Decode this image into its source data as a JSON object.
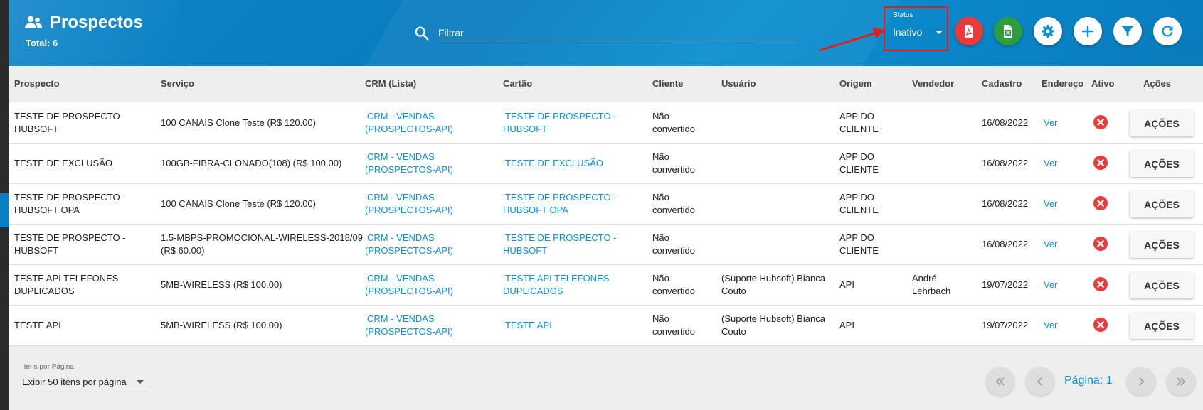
{
  "header": {
    "title": "Prospectos",
    "total": "Total: 6",
    "search_placeholder": "Filtrar",
    "status_label": "Status",
    "status_value": "Inativo"
  },
  "toolbar": {
    "pdf_icon": "pdf-icon",
    "excel_icon": "excel-icon",
    "settings_icon": "gear-icon",
    "add_icon": "plus-icon",
    "filter_icon": "filter-icon",
    "refresh_icon": "refresh-icon"
  },
  "colors": {
    "header": "#0a7fc4",
    "accent_link": "#0a8fd8",
    "danger": "#ea3a3a",
    "excel": "#2e9d3d"
  },
  "columns": [
    "Prospecto",
    "Serviço",
    "CRM (Lista)",
    "Cartão",
    "Cliente",
    "Usuário",
    "Origem",
    "Vendedor",
    "Cadastro",
    "Endereço",
    "Ativo",
    "Ações"
  ],
  "rows": [
    {
      "prospecto": [
        "TESTE DE PROSPECTO -",
        "HUBSOFT"
      ],
      "servico": [
        "100 CANAIS Clone Teste (R$ 120.00)"
      ],
      "crm": [
        "CRM - VENDAS",
        "(PROSPECTOS-API)"
      ],
      "cartao": [
        "TESTE DE PROSPECTO -",
        "HUBSOFT"
      ],
      "cliente": [
        "Não",
        "convertido"
      ],
      "usuario": [],
      "origem": [
        "APP DO",
        "CLIENTE"
      ],
      "vendedor": [],
      "cadastro": "16/08/2022",
      "endereco": "Ver",
      "acoes": "AÇÕES"
    },
    {
      "prospecto": [
        "TESTE DE EXCLUSÃO"
      ],
      "servico": [
        "100GB-FIBRA-CLONADO(108) (R$ 100.00)"
      ],
      "crm": [
        "CRM - VENDAS",
        "(PROSPECTOS-API)"
      ],
      "cartao": [
        "TESTE DE EXCLUSÃO"
      ],
      "cliente": [
        "Não",
        "convertido"
      ],
      "usuario": [],
      "origem": [
        "APP DO",
        "CLIENTE"
      ],
      "vendedor": [],
      "cadastro": "16/08/2022",
      "endereco": "Ver",
      "acoes": "AÇÕES"
    },
    {
      "prospecto": [
        "TESTE DE PROSPECTO -",
        "HUBSOFT OPA"
      ],
      "servico": [
        "100 CANAIS Clone Teste (R$ 120.00)"
      ],
      "crm": [
        "CRM - VENDAS",
        "(PROSPECTOS-API)"
      ],
      "cartao": [
        "TESTE DE PROSPECTO -",
        "HUBSOFT OPA"
      ],
      "cliente": [
        "Não",
        "convertido"
      ],
      "usuario": [],
      "origem": [
        "APP DO",
        "CLIENTE"
      ],
      "vendedor": [],
      "cadastro": "16/08/2022",
      "endereco": "Ver",
      "acoes": "AÇÕES"
    },
    {
      "prospecto": [
        "TESTE DE PROSPECTO -",
        "HUBSOFT"
      ],
      "servico": [
        "1.5-MBPS-PROMOCIONAL-WIRELESS-2018/09",
        "(R$ 60.00)"
      ],
      "crm": [
        "CRM - VENDAS",
        "(PROSPECTOS-API)"
      ],
      "cartao": [
        "TESTE DE PROSPECTO -",
        "HUBSOFT"
      ],
      "cliente": [
        "Não",
        "convertido"
      ],
      "usuario": [],
      "origem": [
        "APP DO",
        "CLIENTE"
      ],
      "vendedor": [],
      "cadastro": "16/08/2022",
      "endereco": "Ver",
      "acoes": "AÇÕES"
    },
    {
      "prospecto": [
        "TESTE API TELEFONES",
        "DUPLICADOS"
      ],
      "servico": [
        "5MB-WIRELESS (R$ 100.00)"
      ],
      "crm": [
        "CRM - VENDAS",
        "(PROSPECTOS-API)"
      ],
      "cartao": [
        "TESTE API TELEFONES",
        "DUPLICADOS"
      ],
      "cliente": [
        "Não",
        "convertido"
      ],
      "usuario": [
        "(Suporte Hubsoft) Bianca",
        "Couto"
      ],
      "origem": [
        "API"
      ],
      "vendedor": [
        "André",
        "Lehrbach"
      ],
      "cadastro": "19/07/2022",
      "endereco": "Ver",
      "acoes": "AÇÕES"
    },
    {
      "prospecto": [
        "TESTE API"
      ],
      "servico": [
        "5MB-WIRELESS (R$ 100.00)"
      ],
      "crm": [
        "CRM - VENDAS",
        "(PROSPECTOS-API)"
      ],
      "cartao": [
        "TESTE API"
      ],
      "cliente": [
        "Não",
        "convertido"
      ],
      "usuario": [
        "(Suporte Hubsoft) Bianca",
        "Couto"
      ],
      "origem": [
        "API"
      ],
      "vendedor": [],
      "cadastro": "19/07/2022",
      "endereco": "Ver",
      "acoes": "AÇÕES"
    }
  ],
  "footer": {
    "items_label": "Itens por Página",
    "items_value": "Exibir 50 itens por página",
    "page_label": "Página: 1"
  }
}
